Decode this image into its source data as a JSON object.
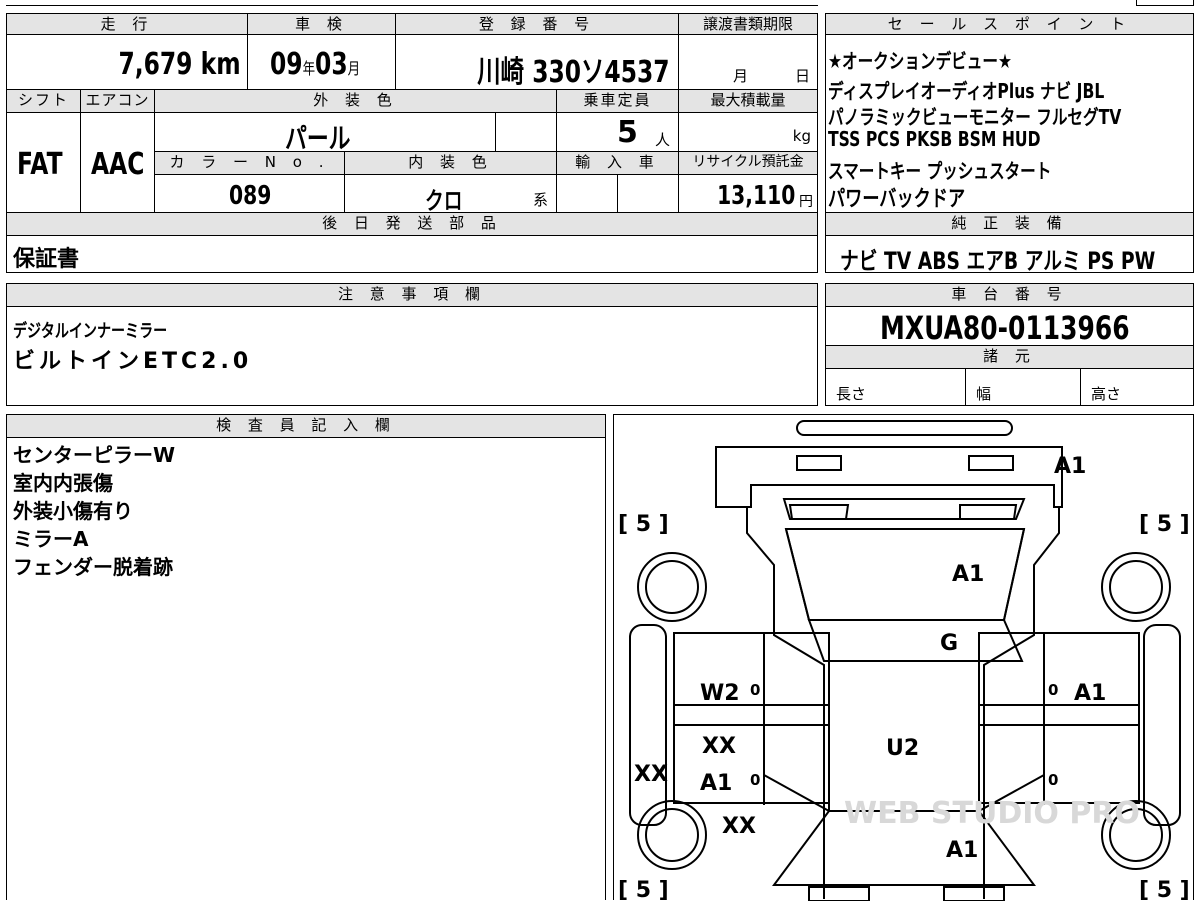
{
  "vehicle": {
    "mileage_header": "走 行",
    "mileage_value": "7,679",
    "mileage_unit": "km",
    "inspection_header": "車 検",
    "inspection_year": "09",
    "inspection_year_unit": "年",
    "inspection_month": "03",
    "inspection_month_unit": "月",
    "registration_header": "登 録 番 号",
    "registration_value": "川崎 330ソ4537",
    "transfer_header": "譲渡書類期限",
    "transfer_month": "月",
    "transfer_day": "日",
    "shift_header": "シフト",
    "shift_value": "FAT",
    "ac_header": "エアコン",
    "ac_value": "AAC",
    "exterior_color_header": "外 装 色",
    "exterior_color_value": "パール",
    "capacity_header": "乗車定員",
    "capacity_value": "5",
    "capacity_unit": "人",
    "max_load_header": "最大積載量",
    "max_load_unit": "kg",
    "color_no_header": "カ ラ ー N o .",
    "color_no_value": "089",
    "interior_color_header": "内 装 色",
    "interior_color_value": "クロ",
    "interior_color_suffix": "系",
    "import_header": "輸 入 車",
    "recycle_header": "リサイクル預託金",
    "recycle_value": "13,110",
    "recycle_unit": "円"
  },
  "sales_points": {
    "header": "セ ー ル ス ポ イ ン ト",
    "lines": [
      "★オークションデビュー★",
      "ディスプレイオーディオPlus ナビ JBL",
      "パノラミックビューモニター フルセグTV",
      "TSS PCS PKSB BSM HUD",
      "スマートキー プッシュスタート",
      "パワーバックドア"
    ]
  },
  "later_parts": {
    "header": "後 日 発 送 部 品",
    "value": "保証書"
  },
  "genuine_equipment": {
    "header": "純 正 装 備",
    "value": "ナビ TV ABS エアB アルミ PS PW"
  },
  "notes": {
    "header": "注 意 事 項 欄",
    "lines": [
      "デジタルインナーミラー",
      "ビルトインETC2.0"
    ]
  },
  "chassis": {
    "header": "車 台 番 号",
    "value": "MXUA80-0113966"
  },
  "specs": {
    "header": "諸 元",
    "length_label": "長さ",
    "width_label": "幅",
    "height_label": "高さ"
  },
  "inspector": {
    "header": "検 査 員 記 入 欄",
    "lines": [
      "センターピラーW",
      "室内内張傷",
      "外装小傷有り",
      "ミラーA",
      "フェンダー脱着跡"
    ]
  },
  "diagram": {
    "tire_marks": [
      "[ 5 ]",
      "[ 5 ]",
      "[ 5 ]",
      "[ 5 ]"
    ],
    "damage_codes": {
      "rear_bumper": "A1",
      "roof": "A1",
      "windshield": "G",
      "left_front_door": "W2",
      "right_front_door": "A1",
      "left_pillar": "XX",
      "left_rear_door_1": "XX",
      "left_rear_door_2": "A1",
      "left_sill": "XX",
      "left_fender": "XX",
      "floor": "U2",
      "front_hood": "A1"
    },
    "zero_marks": [
      "0",
      "0",
      "0",
      "0"
    ],
    "watermark": "WEB STUDIO PRO"
  }
}
